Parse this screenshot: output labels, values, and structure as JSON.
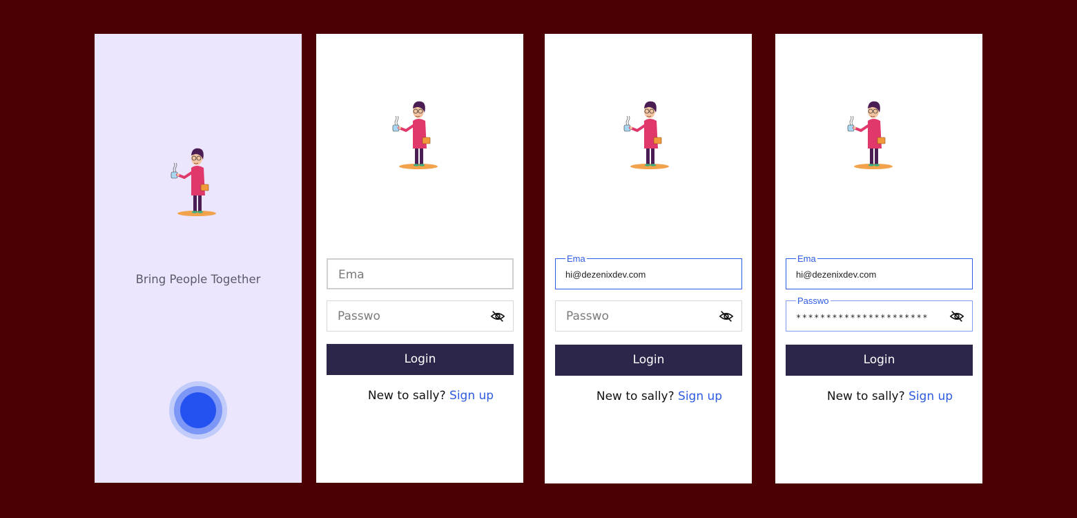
{
  "splash": {
    "tagline": "Bring People Together"
  },
  "login": {
    "email_placeholder": "Ema",
    "password_placeholder": "Passwo",
    "email_label": "Ema",
    "password_label": "Passwo",
    "email_value": "hi@dezenixdev.com",
    "password_value": "**********************",
    "login_button": "Login",
    "signup_prompt": "New to sally?",
    "signup_link": "Sign up"
  },
  "icons": {
    "eye": "eye-off-icon",
    "illustration": "person-with-coffee-illustration",
    "loader": "loading-spinner-icon"
  },
  "colors": {
    "background": "#4b0004",
    "splash_bg": "#ebe6fe",
    "accent": "#2d5be3",
    "button": "#2b264a",
    "loader": "#2452f0"
  }
}
